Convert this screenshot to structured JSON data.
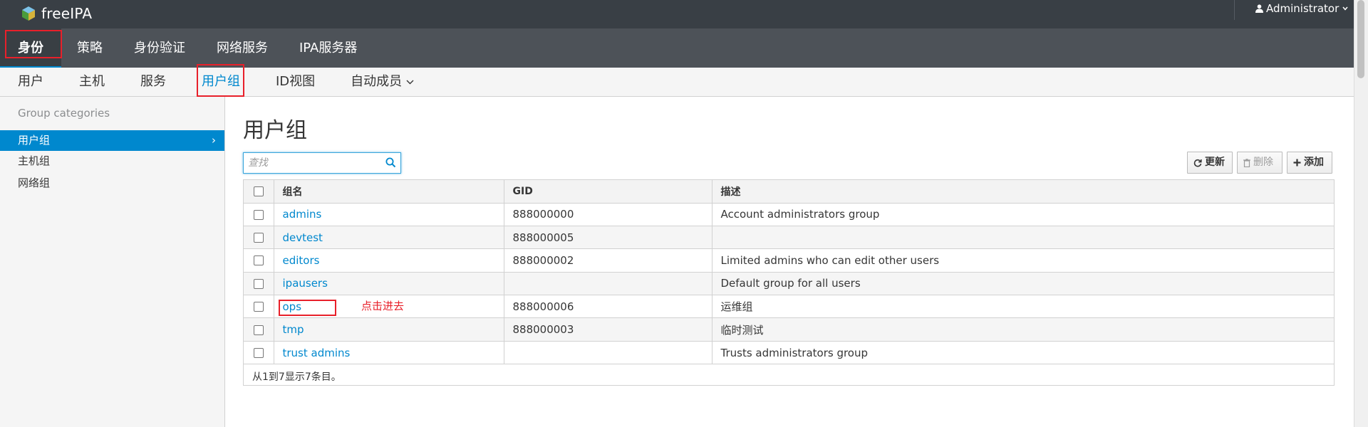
{
  "header": {
    "brand": "freeIPA",
    "user": "Administrator"
  },
  "primary_nav": [
    "身份",
    "策略",
    "身份验证",
    "网络服务",
    "IPA服务器"
  ],
  "secondary_nav": [
    "用户",
    "主机",
    "服务",
    "用户组",
    "ID视图",
    "自动成员"
  ],
  "sidebar": {
    "heading": "Group categories",
    "items": [
      "用户组",
      "主机组",
      "网络组"
    ]
  },
  "main": {
    "title": "用户组",
    "search_placeholder": "查找",
    "buttons": {
      "refresh": "更新",
      "delete": "删除",
      "add": "添加"
    },
    "table": {
      "headers": [
        "组名",
        "GID",
        "描述"
      ],
      "rows": [
        {
          "name": "admins",
          "gid": "888000000",
          "desc": "Account administrators group"
        },
        {
          "name": "devtest",
          "gid": "888000005",
          "desc": ""
        },
        {
          "name": "editors",
          "gid": "888000002",
          "desc": "Limited admins who can edit other users"
        },
        {
          "name": "ipausers",
          "gid": "",
          "desc": "Default group for all users"
        },
        {
          "name": "ops",
          "gid": "888000006",
          "desc": "运维组"
        },
        {
          "name": "tmp",
          "gid": "888000003",
          "desc": "临时测试"
        },
        {
          "name": "trust admins",
          "gid": "",
          "desc": "Trusts administrators group"
        }
      ],
      "footer": "从1到7显示7条目。"
    },
    "annotation": "点击进去"
  },
  "colors": {
    "accent": "#0088ce",
    "annotation": "#e8202a",
    "header_bg": "#393f45",
    "nav_bg": "#4d5258"
  }
}
